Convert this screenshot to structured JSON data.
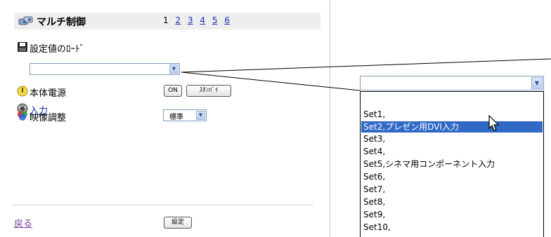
{
  "header": {
    "title": "マルチ制御",
    "current_page": "1",
    "pages": [
      "2",
      "3",
      "4",
      "5",
      "6"
    ]
  },
  "settings_load": {
    "label": "設定値のﾛｰﾄﾞ",
    "selected": ""
  },
  "power": {
    "label": "本体電源",
    "on_label": "ON",
    "standby_label": "ｽﾀﾝﾊﾞｲ"
  },
  "input": {
    "label": "入力"
  },
  "image_adjust": {
    "label": "映像調整",
    "selected": "標準"
  },
  "footer": {
    "back_label": "戻る",
    "set_label": "設定"
  },
  "dropdown": {
    "selected": "",
    "options": [
      "",
      "Set1,",
      "Set2,プレゼン用DVI入力",
      "Set3,",
      "Set4,",
      "Set5,シネマ用コンポーネント入力",
      "Set6,",
      "Set7,",
      "Set8,",
      "Set9,",
      "Set10,"
    ],
    "highlighted_index": 2
  },
  "colors": {
    "highlight": "#3169c6",
    "link": "#1a2db0",
    "visited_link": "#7b3ba8",
    "title_bg": "#eeeeee"
  }
}
